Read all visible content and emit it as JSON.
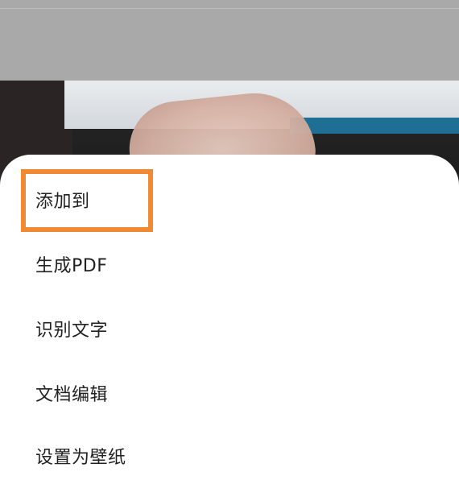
{
  "menu": {
    "items": [
      {
        "label": "添加到"
      },
      {
        "label": "生成PDF"
      },
      {
        "label": "识别文字"
      },
      {
        "label": "文档编辑"
      },
      {
        "label": "设置为壁纸"
      }
    ]
  },
  "colors": {
    "highlight": "#f08a34",
    "sheet_bg": "#ffffff",
    "dim_overlay": "#a9a9a9",
    "text": "#222222"
  }
}
